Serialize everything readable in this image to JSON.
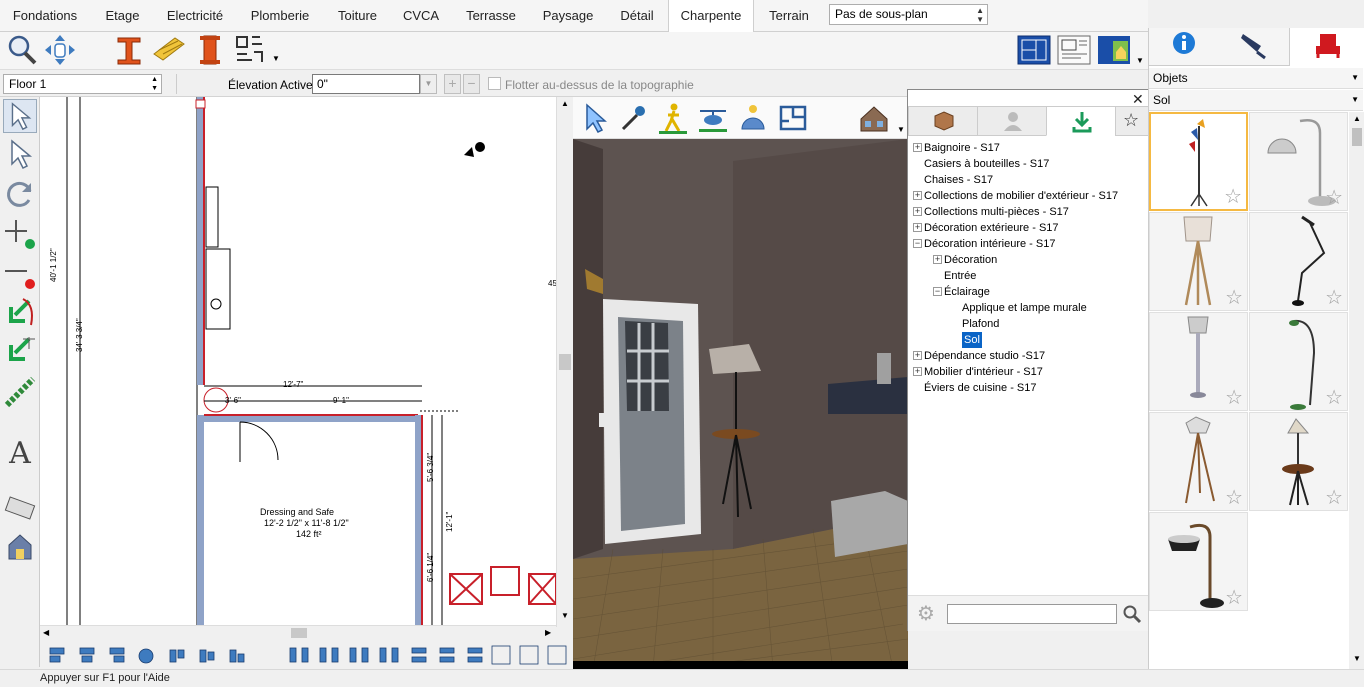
{
  "tabs": [
    {
      "label": "Fondations"
    },
    {
      "label": "Etage"
    },
    {
      "label": "Electricité"
    },
    {
      "label": "Plomberie"
    },
    {
      "label": "Toiture"
    },
    {
      "label": "CVCA"
    },
    {
      "label": "Terrasse"
    },
    {
      "label": "Paysage"
    },
    {
      "label": "Détail"
    },
    {
      "label": "Charpente"
    },
    {
      "label": "Terrain"
    }
  ],
  "active_tab": "Charpente",
  "plan_select": "Pas de sous-plan",
  "options": {
    "floor": "Floor 1",
    "elevation_label": "Élevation Active:",
    "elevation_value": "0\"",
    "float_label": "Flotter au-dessus de la topographie"
  },
  "plan": {
    "room_name": "Dressing and Safe",
    "room_size": "12'-2 1/2\" x 11'-8 1/2\"",
    "room_area": "142 ft²",
    "dim_top": "12'-7\"",
    "dim_9_1": "9'-1\"",
    "dim_3_6": "3'-6\"",
    "dim_40": "40'-1 1/2\"",
    "dim_34": "34'-3 3/4\"",
    "dim_5_6": "5'-6 3/4\"",
    "dim_12_1": "12'-1\"",
    "dim_6_6": "6'-6 1/4\"",
    "dim_45": "45"
  },
  "library": {
    "tree": [
      {
        "label": "Baignoire - S17",
        "level": 0,
        "exp": "+"
      },
      {
        "label": "Casiers à bouteilles - S17",
        "level": 0,
        "exp": ""
      },
      {
        "label": "Chaises - S17",
        "level": 0,
        "exp": ""
      },
      {
        "label": "Collections de mobilier d'extérieur - S17",
        "level": 0,
        "exp": "+"
      },
      {
        "label": "Collections multi-pièces - S17",
        "level": 0,
        "exp": "+"
      },
      {
        "label": "Décoration extérieure - S17",
        "level": 0,
        "exp": "+"
      },
      {
        "label": "Décoration intérieure - S17",
        "level": 0,
        "exp": "−"
      },
      {
        "label": "Décoration",
        "level": 1,
        "exp": "+"
      },
      {
        "label": "Entrée",
        "level": 1,
        "exp": ""
      },
      {
        "label": "Éclairage",
        "level": 1,
        "exp": "−"
      },
      {
        "label": "Applique et lampe murale",
        "level": 2,
        "exp": ""
      },
      {
        "label": "Plafond",
        "level": 2,
        "exp": ""
      },
      {
        "label": "Sol",
        "level": 2,
        "exp": "",
        "selected": true
      },
      {
        "label": "Dépendance studio -S17",
        "level": 0,
        "exp": "+"
      },
      {
        "label": "Mobilier d'intérieur - S17",
        "level": 0,
        "exp": "+"
      },
      {
        "label": "Éviers de cuisine - S17",
        "level": 0,
        "exp": ""
      }
    ]
  },
  "right_panel": {
    "category_select": "Objets",
    "subcategory_select": "Sol"
  },
  "status": "Appuyer sur F1 pour l'Aide",
  "colors": {
    "accent": "#0a64c6",
    "selection_border": "#f5b942",
    "wall_red": "#c8202a",
    "wall_blue": "#8fa3c8"
  }
}
